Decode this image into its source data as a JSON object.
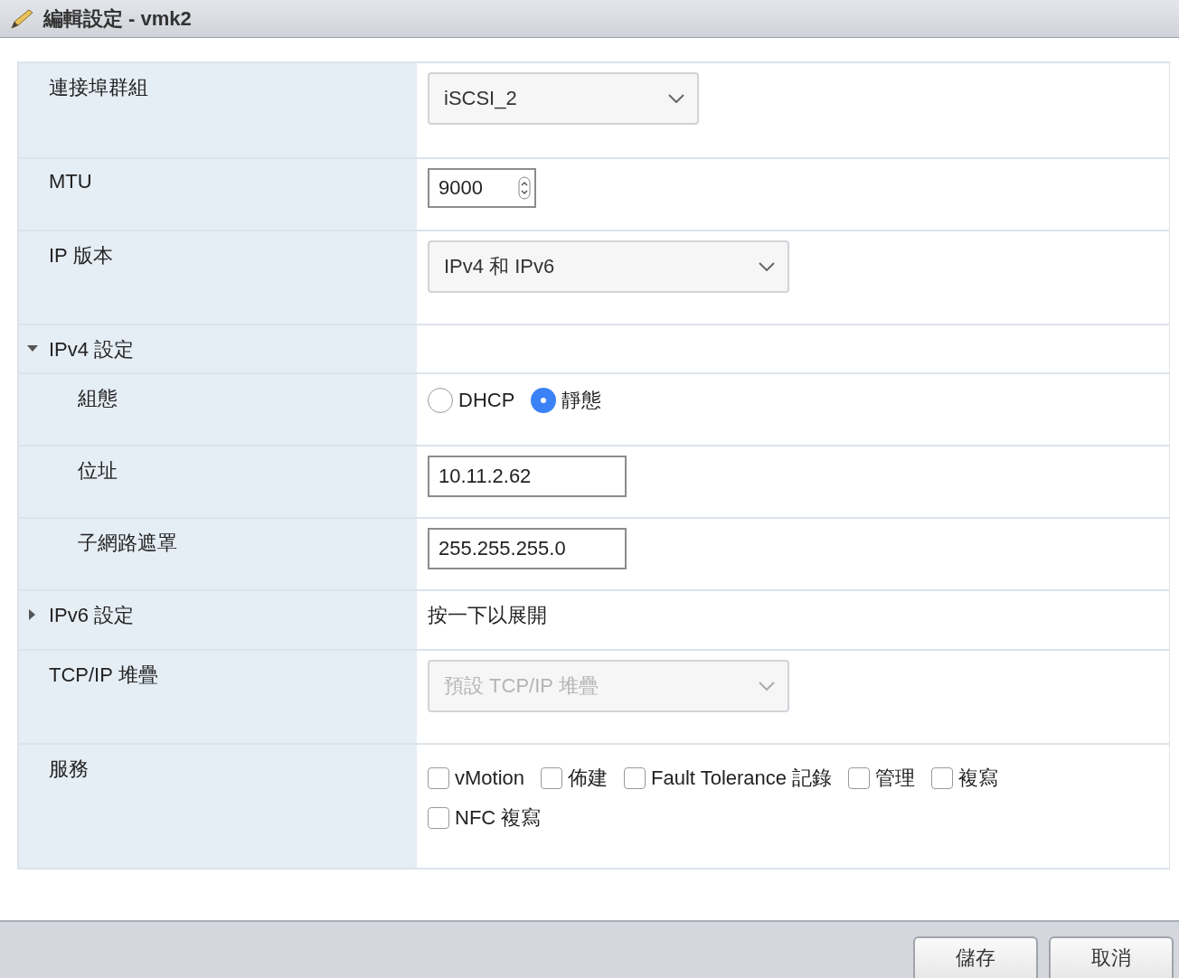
{
  "window": {
    "title": "編輯設定 - vmk2"
  },
  "rows": [
    {
      "kind": "select",
      "label": "連接埠群組",
      "value": "iSCSI_2",
      "disabled": false
    },
    {
      "kind": "number",
      "label": "MTU",
      "value": "9000"
    },
    {
      "kind": "select",
      "label": "IP 版本",
      "value": "IPv4 和 IPv6",
      "disabled": false
    },
    {
      "kind": "section",
      "label": "IPv4 設定",
      "expanded": true,
      "children": [
        {
          "kind": "radio",
          "label": "組態",
          "options": [
            {
              "label": "DHCP",
              "selected": false
            },
            {
              "label": "靜態",
              "selected": true
            }
          ]
        },
        {
          "kind": "text",
          "label": "位址",
          "value": "10.11.2.62"
        },
        {
          "kind": "text",
          "label": "子網路遮罩",
          "value": "255.255.255.0"
        }
      ]
    },
    {
      "kind": "section",
      "label": "IPv6 設定",
      "expanded": false,
      "hint": "按一下以展開"
    },
    {
      "kind": "select",
      "label": "TCP/IP 堆疊",
      "value": "預設 TCP/IP 堆疊",
      "disabled": true
    },
    {
      "kind": "checkboxes",
      "label": "服務",
      "options": [
        {
          "label": "vMotion",
          "checked": false
        },
        {
          "label": "佈建",
          "checked": false
        },
        {
          "label": "Fault Tolerance 記錄",
          "checked": false
        },
        {
          "label": "管理",
          "checked": false
        },
        {
          "label": "複寫",
          "checked": false
        },
        {
          "label": "NFC 複寫",
          "checked": false
        }
      ]
    }
  ],
  "buttons": [
    "儲存",
    "取消"
  ]
}
